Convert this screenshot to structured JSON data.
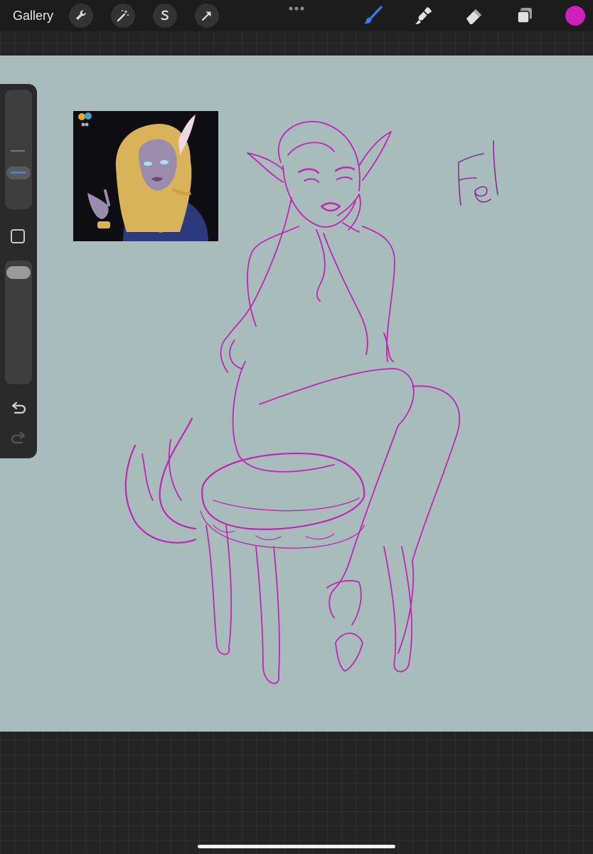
{
  "toolbar": {
    "gallery_label": "Gallery",
    "left_tools": [
      "wrench-icon",
      "magic-wand-icon",
      "selection-icon",
      "transform-arrow-icon"
    ],
    "right_tools": [
      "brush-icon",
      "smudge-icon",
      "eraser-icon",
      "layers-icon"
    ],
    "active_tool": "brush-icon",
    "active_tool_color": "#3b7bf0",
    "current_color": "#cc22bb"
  },
  "canvas": {
    "background_color": "#a8bcbc",
    "line_color": "#c026b5",
    "handwritten_text": "Fel"
  },
  "sidebar": {
    "brush_size_handle_color": "#4a7bf0",
    "opacity_handle_color": "#9a9a9a",
    "icons": [
      "modify-square-icon",
      "undo-icon",
      "redo-icon"
    ]
  },
  "reference": {
    "palette_colors": [
      "#e0a93b",
      "#3aa6c4",
      "#c9a0b8",
      "#8bc0d8"
    ]
  }
}
